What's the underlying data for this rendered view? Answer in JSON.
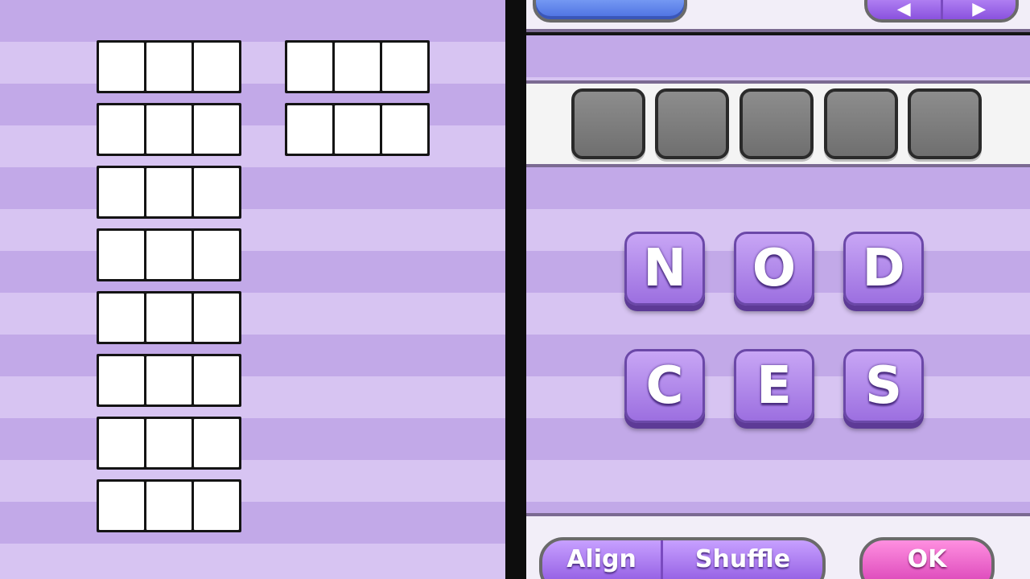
{
  "left_screen": {
    "word_slots": [
      {
        "letters": 3,
        "filled": ""
      },
      {
        "letters": 3,
        "filled": ""
      },
      {
        "letters": 3,
        "filled": ""
      },
      {
        "letters": 3,
        "filled": ""
      },
      {
        "letters": 3,
        "filled": ""
      },
      {
        "letters": 3,
        "filled": ""
      },
      {
        "letters": 3,
        "filled": ""
      },
      {
        "letters": 3,
        "filled": ""
      },
      {
        "letters": 3,
        "filled": ""
      },
      {
        "letters": 3,
        "filled": ""
      }
    ]
  },
  "right_screen": {
    "answer_boxes": 5,
    "letter_tiles": [
      "N",
      "O",
      "D",
      "C",
      "E",
      "S"
    ],
    "buttons": {
      "align": "Align",
      "shuffle": "Shuffle",
      "ok": "OK"
    }
  },
  "colors": {
    "background": "#d7c4f2",
    "diamond": "#c2a9e8",
    "tile": "#a97ee6",
    "ok_button": "#e356c4",
    "pause_button": "#4b6fe0"
  }
}
